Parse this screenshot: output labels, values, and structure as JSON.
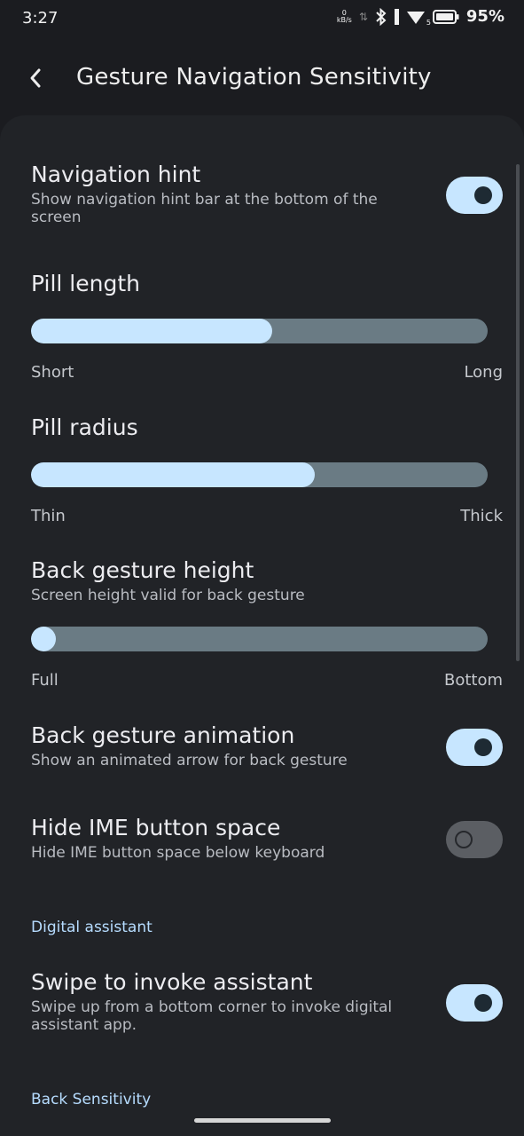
{
  "status": {
    "time": "3:27",
    "net_speed_top": "0",
    "net_speed_unit": "kB/s",
    "sim_label": "5",
    "battery": "95%"
  },
  "appbar": {
    "title": "Gesture Navigation Sensitivity"
  },
  "settings": {
    "nav_hint": {
      "title": "Navigation hint",
      "subtitle": "Show navigation hint bar at the bottom of the screen",
      "enabled": true
    },
    "pill_length": {
      "title": "Pill length",
      "min_label": "Short",
      "max_label": "Long",
      "value": 0.53
    },
    "pill_radius": {
      "title": "Pill radius",
      "min_label": "Thin",
      "max_label": "Thick",
      "value": 0.62
    },
    "back_height": {
      "title": "Back gesture height",
      "subtitle": "Screen height valid for back gesture",
      "min_label": "Full",
      "max_label": "Bottom",
      "value": 0.0
    },
    "back_anim": {
      "title": "Back gesture animation",
      "subtitle": "Show an animated arrow for back gesture",
      "enabled": true
    },
    "hide_ime": {
      "title": "Hide IME button space",
      "subtitle": "Hide IME button space below keyboard",
      "enabled": false
    }
  },
  "sections": {
    "digital_assistant": "Digital assistant",
    "back_sensitivity": "Back Sensitivity"
  },
  "assistant": {
    "swipe": {
      "title": "Swipe to invoke assistant",
      "subtitle": "Swipe up from a bottom corner to invoke digital assistant app.",
      "enabled": true
    }
  },
  "colors": {
    "accent": "#c7e6ff",
    "track": "#6a7b84",
    "background": "#212327"
  }
}
